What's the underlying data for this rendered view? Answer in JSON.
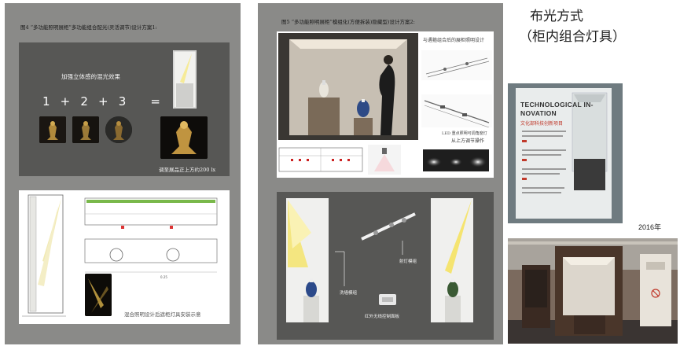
{
  "left_panel": {
    "fig_title": "图4 “多功能照明展柜”多功能组合配光(灵活调节)设计方案1:",
    "effect_label": "加强立体感的混光效果",
    "formula": [
      "1",
      "+",
      "2",
      "+",
      "3",
      "="
    ],
    "lux_note": "调至展品正上方约200 lx",
    "install_caption": "混合照明设计后遮柜灯具安装示意"
  },
  "mid_panel": {
    "fig_title": "图5 “多功能照明展柜”模组化(方便拆装)隐藏型)设计方案2:",
    "combo_note": "与遇箍组合后的展柜照明设计",
    "led_note_1": "LED 重点照明可调角度灯",
    "led_note_2": "从上方调节操作",
    "wash_label": "洗墙模组",
    "spot_label": "射灯模组",
    "ir_label": "红外无线控制面板"
  },
  "right_panel": {
    "title_line1": "布光方式",
    "title_line2": "（柜内组合灯具）",
    "poster_line1": "TECHNOLOGICAL IN-",
    "poster_line2": "NOVATION",
    "poster_cn": "文化部科技创新项目",
    "year": "2016年"
  },
  "colors": {
    "panel_gray": "#8a8a88",
    "dark_gray": "#575755",
    "light_yellow": "#f6eb98"
  }
}
